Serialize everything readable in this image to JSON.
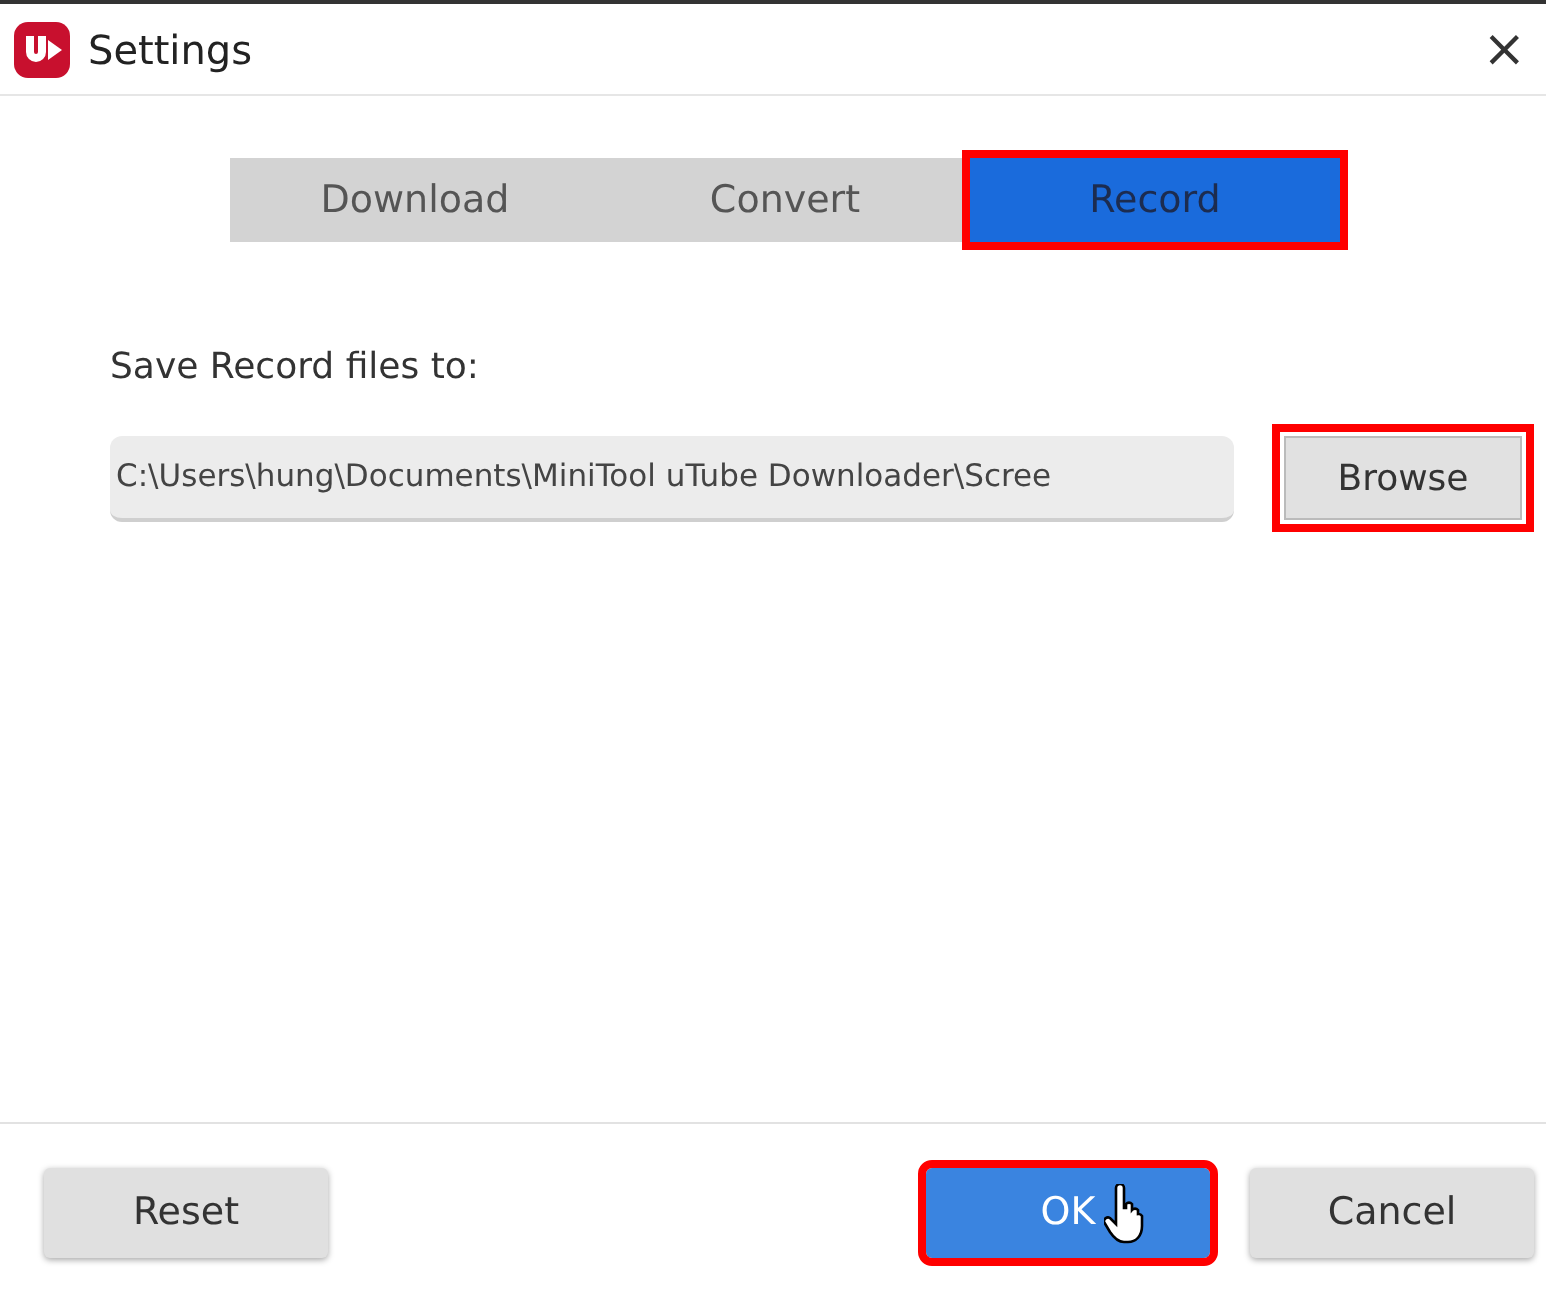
{
  "window": {
    "title": "Settings",
    "close": "×"
  },
  "tabs": [
    {
      "label": "Download",
      "selected": false,
      "highlighted": false
    },
    {
      "label": "Convert",
      "selected": false,
      "highlighted": false
    },
    {
      "label": "Record",
      "selected": true,
      "highlighted": true
    }
  ],
  "save_location": {
    "label": "Save Record files to:",
    "value": "C:\\Users\\hung\\Documents\\MiniTool uTube Downloader\\Scree",
    "browse": {
      "label": "Browse",
      "highlighted": true
    }
  },
  "footer_buttons": [
    {
      "label": "Reset",
      "kind": "plain",
      "highlighted": false,
      "hovered": false
    },
    {
      "label": "OK",
      "kind": "primary",
      "highlighted": true,
      "hovered": true
    },
    {
      "label": "Cancel",
      "kind": "plain",
      "highlighted": false,
      "hovered": false
    }
  ]
}
